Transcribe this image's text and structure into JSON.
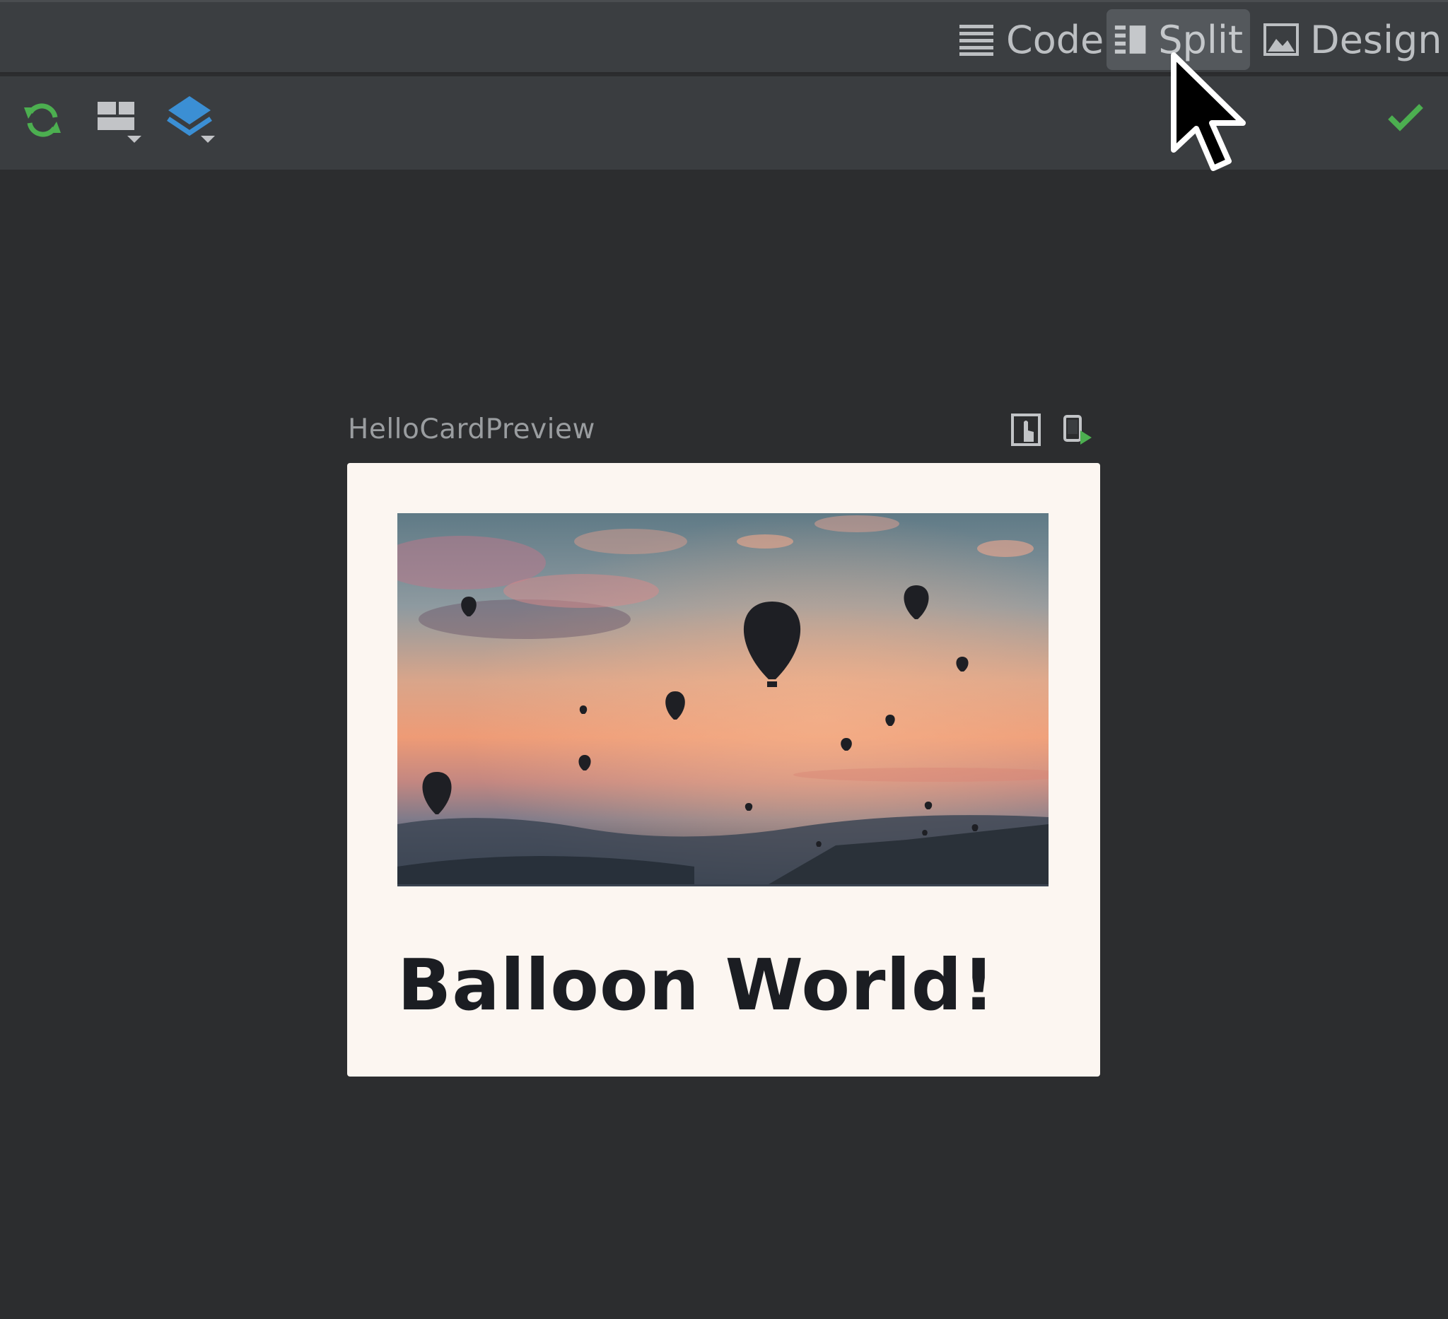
{
  "view_modes": {
    "code_label": "Code",
    "split_label": "Split",
    "design_label": "Design",
    "active": "Split"
  },
  "toolbar": {
    "icons": [
      "refresh-icon",
      "layout-grid-icon",
      "layers-icon"
    ],
    "status_icon": "checkmark-icon"
  },
  "preview": {
    "name": "HelloCardPreview",
    "actions": [
      "interactive-mode-icon",
      "deploy-to-device-icon"
    ]
  },
  "card": {
    "title": "Balloon World!",
    "image": "hot-air-balloons-sunset-photo"
  },
  "colors": {
    "accent_green": "#4caf50",
    "layers_blue": "#3b8fd4",
    "card_bg": "#fcf6f1"
  }
}
